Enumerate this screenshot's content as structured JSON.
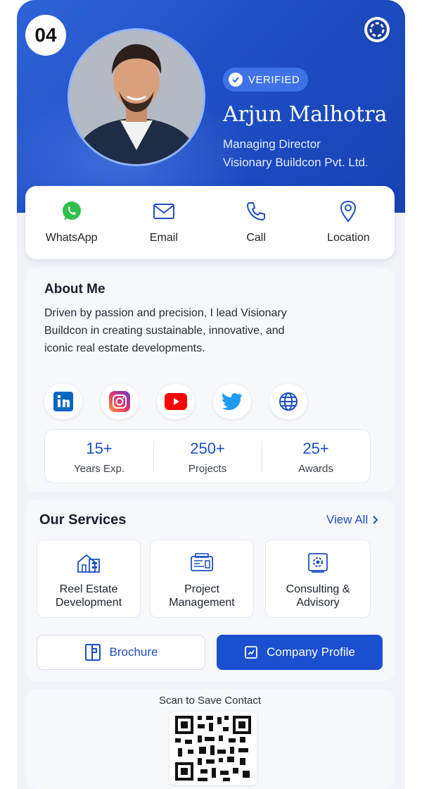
{
  "card_number": "04",
  "profile": {
    "verified_label": "VERIFIED",
    "name": "Arjun Malhotra",
    "title": "Managing Director",
    "company": "Visionary Buildcon Pvt. Ltd."
  },
  "contact": [
    {
      "label": "WhatsApp",
      "icon": "whatsapp-icon"
    },
    {
      "label": "Email",
      "icon": "mail-icon"
    },
    {
      "label": "Call",
      "icon": "phone-icon"
    },
    {
      "label": "Location",
      "icon": "location-pin-icon"
    }
  ],
  "about": {
    "heading": "About Me",
    "text": "Driven by passion and precision, I lead Visionary Buildcon in creating sustainable, innovative, and iconic real estate developments."
  },
  "socials": [
    "linkedin-icon",
    "instagram-icon",
    "youtube-icon",
    "twitter-icon",
    "globe-icon"
  ],
  "stats": [
    {
      "value": "15+",
      "label": "Years Exp."
    },
    {
      "value": "250+",
      "label": "Projects"
    },
    {
      "value": "25+",
      "label": "Awards"
    }
  ],
  "services": {
    "heading": "Our Services",
    "view_all": "View All",
    "items": [
      {
        "line1": "Reel Estate",
        "line2": "Development",
        "icon": "building-icon"
      },
      {
        "line1": "Project",
        "line2": "Management",
        "icon": "blueprint-icon"
      },
      {
        "line1": "Consulting &",
        "line2": "Advisory",
        "icon": "consulting-gear-icon"
      }
    ],
    "brochure_label": "Brochure",
    "company_profile_label": "Company Profile"
  },
  "qr": {
    "caption": "Scan to Save Contact"
  },
  "colors": {
    "brand_blue": "#1a4fd0",
    "hero_blue": "#1f4fc6",
    "background": "#f1f3f8"
  }
}
